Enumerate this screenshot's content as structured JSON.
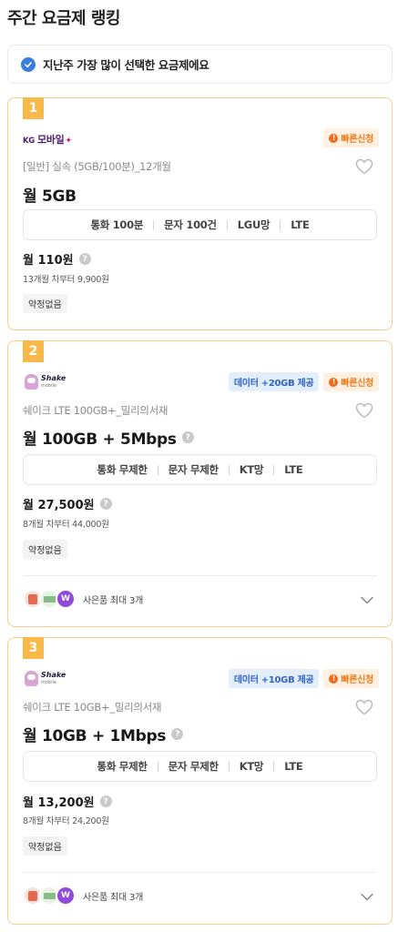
{
  "page_title": "주간 요금제 랭킹",
  "notice": {
    "text": "지난주 가장 많이 선택한 요금제에요",
    "icon": "check-badge-icon"
  },
  "colors": {
    "accent_orange": "#f8b94a",
    "card_border": "#f6cf8c",
    "data_badge_text": "#3165c4",
    "fast_badge_text": "#ed7d1b"
  },
  "cards": [
    {
      "rank": "1",
      "brand": {
        "prefix": "KG",
        "name": "모바일",
        "mark": "✦",
        "type": "kg"
      },
      "badges": {
        "data": "",
        "fast": "빠른신청"
      },
      "plan_name": "[일반] 실속 (5GB/100분)_12개월",
      "headline": "월 5GB",
      "specs": [
        "통화 100분",
        "문자 100건",
        "LGU망",
        "LTE"
      ],
      "price": "월 110원",
      "after_price": "13개월 차부터 9,900원",
      "contract": "약정없음"
    },
    {
      "rank": "2",
      "brand": {
        "name": "Shake",
        "sub": "mobile",
        "type": "shake"
      },
      "badges": {
        "data": "데이터 +20GB 제공",
        "fast": "빠른신청"
      },
      "plan_name": "쉐이크 LTE 100GB+_밀리의서재",
      "headline": "월 100GB + 5Mbps",
      "specs": [
        "통화 무제한",
        "문자 무제한",
        "KT망",
        "LTE"
      ],
      "price": "월 27,500원",
      "after_price": "8개월 차부터 44,000원",
      "contract": "약정없음",
      "gifts_text": "사은품 최대 3개"
    },
    {
      "rank": "3",
      "brand": {
        "name": "Shake",
        "sub": "mobile",
        "type": "shake"
      },
      "badges": {
        "data": "데이터 +10GB 제공",
        "fast": "빠른신청"
      },
      "plan_name": "쉐이크 LTE 10GB+_밀리의서재",
      "headline": "월 10GB + 1Mbps",
      "specs": [
        "통화 무제한",
        "문자 무제한",
        "KT망",
        "LTE"
      ],
      "price": "월 13,200원",
      "after_price": "8개월 차부터 24,200원",
      "contract": "약정없음",
      "gifts_text": "사은품 최대 3개"
    }
  ]
}
